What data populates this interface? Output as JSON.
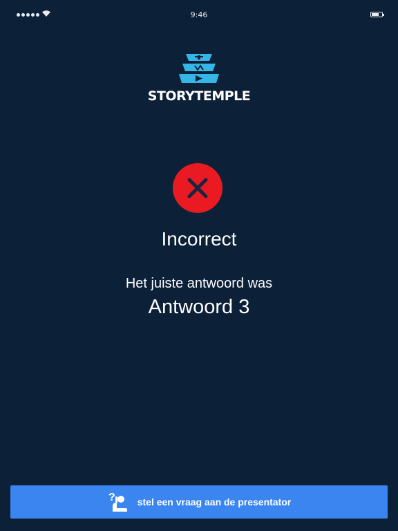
{
  "status_bar": {
    "time": "9:46"
  },
  "logo": {
    "text": "STORYTEMPLE",
    "icon": "temple-logo-icon"
  },
  "result": {
    "icon": "close-icon",
    "icon_color": "#ea1a22",
    "title": "Incorrect",
    "answer_label": "Het juiste antwoord was",
    "answer_value": "Antwoord 3"
  },
  "ask_button": {
    "icon": "raise-hand-question-icon",
    "label": "stel een vraag aan de presentator",
    "color": "#3b85f0"
  },
  "theme": {
    "background": "#0c2038",
    "logo_accent": "#35b6e6"
  }
}
